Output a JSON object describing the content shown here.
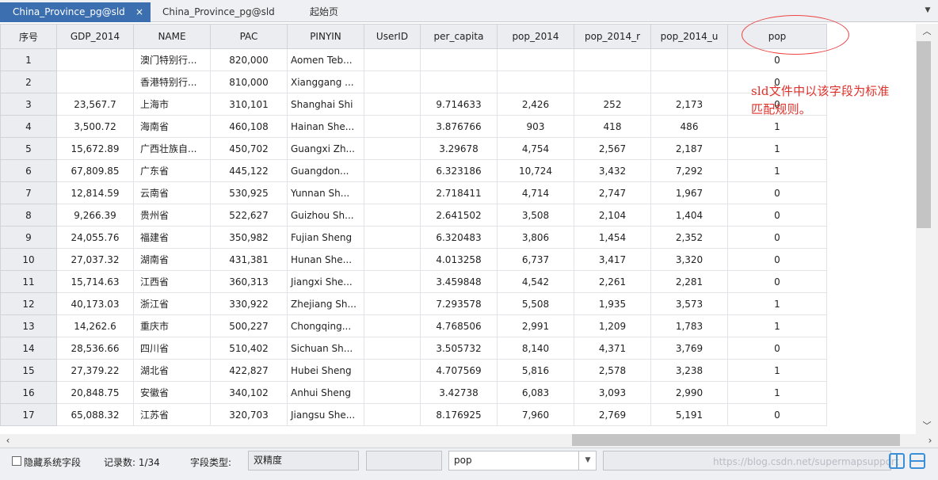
{
  "tabs": [
    {
      "label": "China_Province_pg@sld",
      "close": "×"
    },
    {
      "label": "China_Province_pg@sld"
    },
    {
      "label": "起始页"
    }
  ],
  "tab_menu_icon": "chevron-down-icon",
  "columns": [
    "序号",
    "GDP_2014",
    "NAME",
    "PAC",
    "PINYIN",
    "UserID",
    "per_capita",
    "pop_2014",
    "pop_2014_r",
    "pop_2014_u",
    "pop"
  ],
  "rows": [
    [
      "1",
      "",
      "澳门特别行...",
      "820,000",
      "Aomen Teb...",
      "",
      "",
      "",
      "",
      "",
      "0"
    ],
    [
      "2",
      "",
      "香港特别行...",
      "810,000",
      "Xianggang ...",
      "",
      "",
      "",
      "",
      "",
      "0"
    ],
    [
      "3",
      "23,567.7",
      "上海市",
      "310,101",
      "Shanghai Shi",
      "",
      "9.714633",
      "2,426",
      "252",
      "2,173",
      "0"
    ],
    [
      "4",
      "3,500.72",
      "海南省",
      "460,108",
      "Hainan She...",
      "",
      "3.876766",
      "903",
      "418",
      "486",
      "1"
    ],
    [
      "5",
      "15,672.89",
      "广西壮族自...",
      "450,702",
      "Guangxi Zh...",
      "",
      "3.29678",
      "4,754",
      "2,567",
      "2,187",
      "1"
    ],
    [
      "6",
      "67,809.85",
      "广东省",
      "445,122",
      "Guangdon...",
      "",
      "6.323186",
      "10,724",
      "3,432",
      "7,292",
      "1"
    ],
    [
      "7",
      "12,814.59",
      "云南省",
      "530,925",
      "Yunnan Sh...",
      "",
      "2.718411",
      "4,714",
      "2,747",
      "1,967",
      "0"
    ],
    [
      "8",
      "9,266.39",
      "贵州省",
      "522,627",
      "Guizhou Sh...",
      "",
      "2.641502",
      "3,508",
      "2,104",
      "1,404",
      "0"
    ],
    [
      "9",
      "24,055.76",
      "福建省",
      "350,982",
      "Fujian Sheng",
      "",
      "6.320483",
      "3,806",
      "1,454",
      "2,352",
      "0"
    ],
    [
      "10",
      "27,037.32",
      "湖南省",
      "431,381",
      "Hunan She...",
      "",
      "4.013258",
      "6,737",
      "3,417",
      "3,320",
      "0"
    ],
    [
      "11",
      "15,714.63",
      "江西省",
      "360,313",
      "Jiangxi She...",
      "",
      "3.459848",
      "4,542",
      "2,261",
      "2,281",
      "0"
    ],
    [
      "12",
      "40,173.03",
      "浙江省",
      "330,922",
      "Zhejiang Sh...",
      "",
      "7.293578",
      "5,508",
      "1,935",
      "3,573",
      "1"
    ],
    [
      "13",
      "14,262.6",
      "重庆市",
      "500,227",
      "Chongqing...",
      "",
      "4.768506",
      "2,991",
      "1,209",
      "1,783",
      "1"
    ],
    [
      "14",
      "28,536.66",
      "四川省",
      "510,402",
      "Sichuan Sh...",
      "",
      "3.505732",
      "8,140",
      "4,371",
      "3,769",
      "0"
    ],
    [
      "15",
      "27,379.22",
      "湖北省",
      "422,827",
      "Hubei Sheng",
      "",
      "4.707569",
      "5,816",
      "2,578",
      "3,238",
      "1"
    ],
    [
      "16",
      "20,848.75",
      "安徽省",
      "340,102",
      "Anhui Sheng",
      "",
      "3.42738",
      "6,083",
      "3,093",
      "2,990",
      "1"
    ],
    [
      "17",
      "65,088.32",
      "江苏省",
      "320,703",
      "Jiangsu She...",
      "",
      "8.176925",
      "7,960",
      "2,769",
      "5,191",
      "0"
    ]
  ],
  "annotation": {
    "line1": "sld文件中以该字段为标准",
    "line2": "匹配规则。",
    "color": "#e0302a"
  },
  "status": {
    "hide_fields_label": "隐藏系统字段",
    "record_count": "记录数: 1/34",
    "field_type_label": "字段类型:",
    "field_type_value": "双精度",
    "field_select_value": "pop",
    "dropdown_icon": "chevron-down-icon",
    "watermark": "https://blog.csdn.net/supermapsupport"
  },
  "icons": {
    "scroll_up": "chevron-up-icon",
    "scroll_down": "chevron-down-icon",
    "scroll_left": "chevron-left-icon",
    "scroll_right": "chevron-right-icon",
    "view_a": "split-vertical-icon",
    "view_b": "split-horizontal-icon"
  },
  "colors": {
    "active_tab": "#3c6fb0",
    "header_bg": "#ebedf1",
    "accent_blue": "#3b8fd9"
  }
}
